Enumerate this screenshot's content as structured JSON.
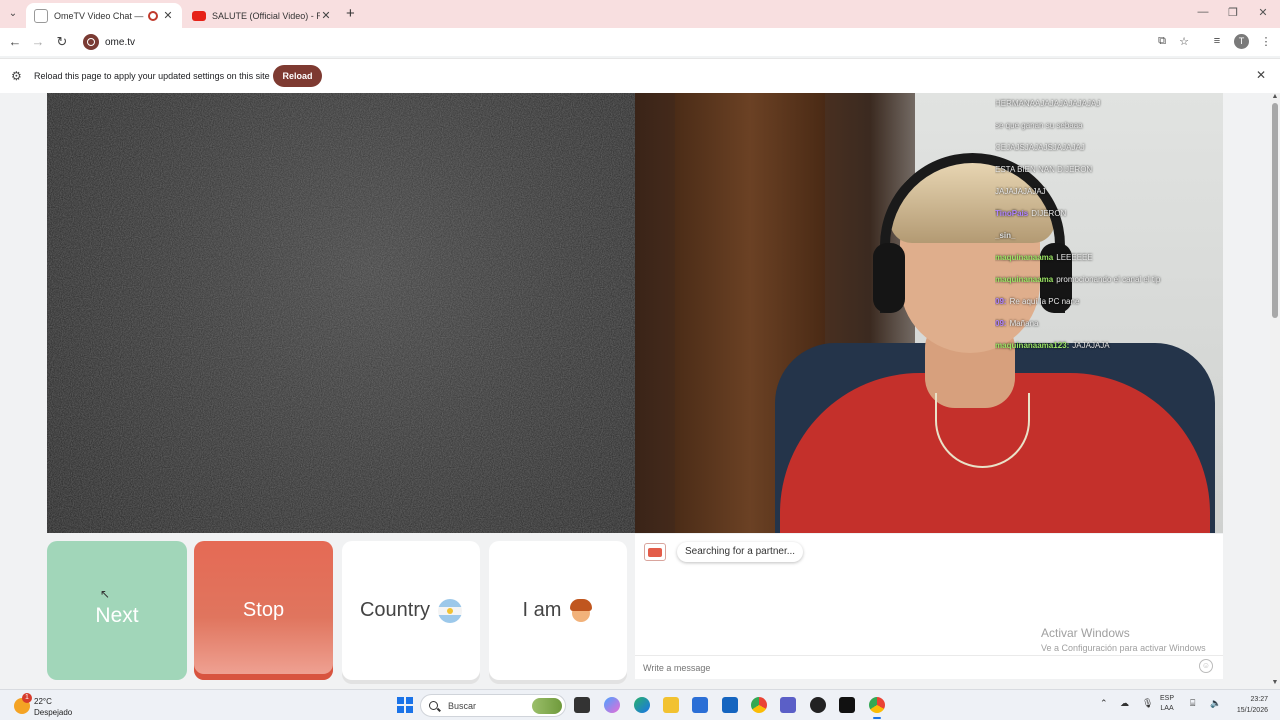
{
  "browser": {
    "tabs": [
      {
        "title": "OmeTV Video Chat — Ome",
        "active": true
      },
      {
        "title": "SALUTE (Official Video) - Raj M",
        "active": false
      }
    ],
    "new_tab_glyph": "+",
    "url": "ome.tv",
    "infobar": {
      "message": "Reload this page to apply your updated settings on this site",
      "button": "Reload"
    },
    "profile_initial": "T"
  },
  "stream_chat": [
    {
      "user": "",
      "text": "HERMANAAJAJAJAJAJAJAJ",
      "color": "#ffffff"
    },
    {
      "user": "",
      "text": "se que ganan su sebaaa",
      "color": "#e0e0e0"
    },
    {
      "user": "",
      "text": "CEJAJSJAJAJSJAJAJAJ",
      "color": "#e0e0e0"
    },
    {
      "user": "",
      "text": "ESTA BIEN NAN DIJERON",
      "color": "#e0e0e0"
    },
    {
      "user": "",
      "text": "JAJAJAJAJAJ",
      "color": "#e0e0e0"
    },
    {
      "user": "TinoPais",
      "text": "DIJERON",
      "color": "#b084ff"
    },
    {
      "user": "_sin_",
      "text": "",
      "color": "#e0e0e0"
    },
    {
      "user": "maquinanaama",
      "text": "LEEEEEE",
      "color": "#9be564"
    },
    {
      "user": "maquinanaama",
      "text": "promocionando el canal el tip",
      "color": "#9be564"
    },
    {
      "user": "09:",
      "text": "Re aquí la PC nane",
      "color": "#b084ff"
    },
    {
      "user": "09:",
      "text": "Mañana",
      "color": "#b084ff"
    },
    {
      "user": "maquinanaama123:",
      "text": "JAJAJAJA",
      "color": "#9be564"
    }
  ],
  "controls": {
    "next": "Next",
    "stop": "Stop",
    "country": "Country",
    "iam": "I am"
  },
  "chat": {
    "status": "Searching for a partner...",
    "placeholder": "Write a message",
    "watermark_title": "Activar Windows",
    "watermark_sub": "Ve a Configuración para activar Windows"
  },
  "taskbar": {
    "weather_temp": "22°C",
    "weather_cond": "Despejado",
    "weather_badge": "1",
    "search_label": "Buscar",
    "lang_top": "ESP",
    "lang_bottom": "LAA",
    "time": "23:27",
    "date": "15/1/2026"
  },
  "colors": {
    "next": "#a1d6b9",
    "stop": "#e56a55",
    "reload": "#7e3a31",
    "tabstrip": "#f8dfe0"
  }
}
